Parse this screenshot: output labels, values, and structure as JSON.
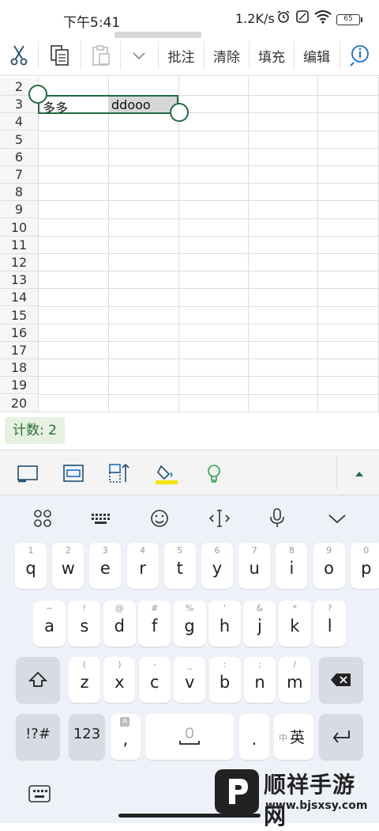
{
  "status_bar": {
    "time": "下午5:41",
    "network_speed": "1.2K/s",
    "battery": "65"
  },
  "toolbar": {
    "cut_icon": "scissors-icon",
    "copy_icon": "copy-icon",
    "paste_icon": "paste-icon",
    "more_icon": "chevron-down-icon",
    "comment_label": "批注",
    "clear_label": "清除",
    "fill_label": "填充",
    "edit_label": "编辑",
    "info_icon": "info-icon"
  },
  "sheet": {
    "rows": [
      "2",
      "3",
      "4",
      "5",
      "6",
      "7",
      "8",
      "9",
      "10",
      "11",
      "12",
      "13",
      "14",
      "15",
      "16",
      "17",
      "18",
      "19",
      "20"
    ],
    "cells": {
      "A3": "多多",
      "B3": "ddooo"
    },
    "accent": "#1e6b40"
  },
  "count_bar": {
    "label": "计数: 2"
  },
  "format_bar": {
    "icons": [
      "border-icon",
      "merge-icon",
      "row-height-icon",
      "fill-color-icon",
      "idea-icon",
      "expand-up-icon"
    ],
    "fill_color": "#f5e400"
  },
  "keyboard": {
    "top_icons": [
      "apps-icon",
      "keyboard-icon",
      "emoji-icon",
      "cursor-icon",
      "mic-icon",
      "collapse-icon"
    ],
    "row1": [
      {
        "sub": "1",
        "main": "q"
      },
      {
        "sub": "2",
        "main": "w"
      },
      {
        "sub": "3",
        "main": "e"
      },
      {
        "sub": "4",
        "main": "r"
      },
      {
        "sub": "5",
        "main": "t"
      },
      {
        "sub": "6",
        "main": "y"
      },
      {
        "sub": "7",
        "main": "u"
      },
      {
        "sub": "8",
        "main": "i"
      },
      {
        "sub": "9",
        "main": "o"
      },
      {
        "sub": "0",
        "main": "p"
      }
    ],
    "row2": [
      {
        "sub": "~",
        "main": "a"
      },
      {
        "sub": "!",
        "main": "s"
      },
      {
        "sub": "@",
        "main": "d"
      },
      {
        "sub": "#",
        "main": "f"
      },
      {
        "sub": "%",
        "main": "g"
      },
      {
        "sub": "'",
        "main": "h"
      },
      {
        "sub": "&",
        "main": "j"
      },
      {
        "sub": "*",
        "main": "k"
      },
      {
        "sub": "?",
        "main": "l"
      }
    ],
    "row3": [
      {
        "sub": "(",
        "main": "z"
      },
      {
        "sub": ")",
        "main": "x"
      },
      {
        "sub": "-",
        "main": "c"
      },
      {
        "sub": "_",
        "main": "v"
      },
      {
        "sub": ":",
        "main": "b"
      },
      {
        "sub": ";",
        "main": "n"
      },
      {
        "sub": "/",
        "main": "m"
      }
    ],
    "symbols_label": "!?#",
    "numbers_label": "123",
    "comma_label": ",",
    "period_label": ".",
    "lang_small": "中",
    "lang_main": "英"
  },
  "watermark": {
    "title": "顺祥手游网",
    "url": "www.bjsxsy.com"
  }
}
